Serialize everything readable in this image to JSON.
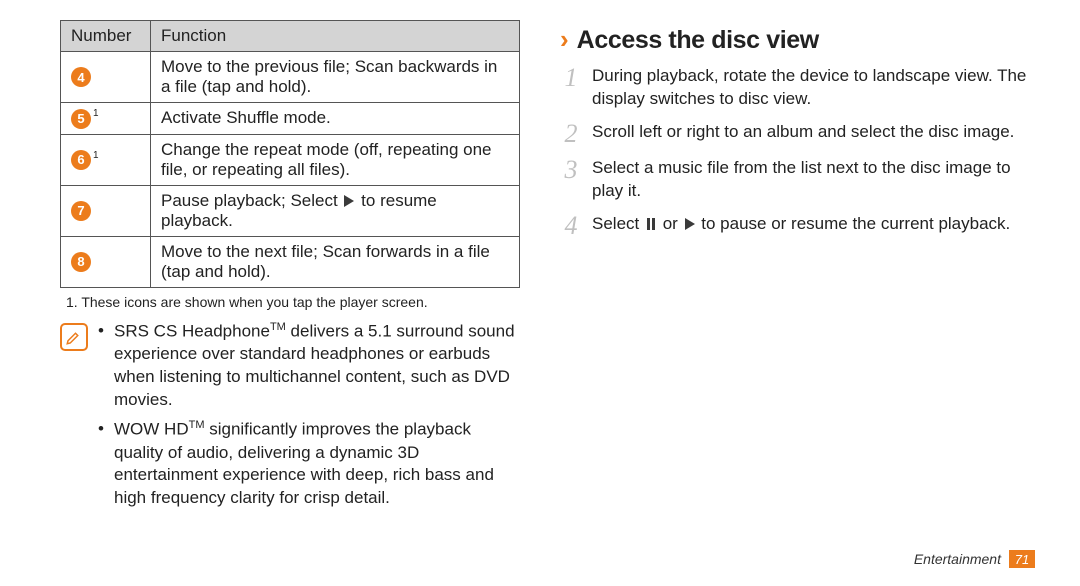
{
  "table": {
    "headers": {
      "number": "Number",
      "function": "Function"
    },
    "rows": [
      {
        "num": "4",
        "sup": "",
        "desc": "Move to the previous file; Scan backwards in a file (tap and hold)."
      },
      {
        "num": "5",
        "sup": "1",
        "desc": "Activate Shuffle mode."
      },
      {
        "num": "6",
        "sup": "1",
        "desc": "Change the repeat mode (off, repeating one file, or repeating all files)."
      },
      {
        "num": "7",
        "sup": "",
        "desc_pre": "Pause playback; Select ",
        "desc_post": " to resume playback."
      },
      {
        "num": "8",
        "sup": "",
        "desc": "Move to the next file; Scan forwards in a file (tap and hold)."
      }
    ]
  },
  "footnote": "1. These icons are shown when you tap the player screen.",
  "notes": {
    "items": [
      {
        "pre": "SRS CS Headphone",
        "tm": "TM",
        "post": " delivers a 5.1 surround sound experience over standard headphones or earbuds when listening to multichannel content, such as DVD movies."
      },
      {
        "pre": "WOW HD",
        "tm": "TM",
        "post": " significantly improves the playback quality of audio, delivering a dynamic 3D entertainment experience with deep, rich bass and high frequency clarity for crisp detail."
      }
    ]
  },
  "section": {
    "chevron": "›",
    "title": "Access the disc view",
    "steps": [
      {
        "n": "1",
        "text": "During playback, rotate the device to landscape view. The display switches to disc view."
      },
      {
        "n": "2",
        "text": "Scroll left or right to an album and select the disc image."
      },
      {
        "n": "3",
        "text": "Select a music file from the list next to the disc image to play it."
      },
      {
        "n": "4",
        "pre": "Select ",
        "mid": " or ",
        "post": " to pause or resume the current playback."
      }
    ]
  },
  "footer": {
    "section": "Entertainment",
    "page": "71"
  }
}
